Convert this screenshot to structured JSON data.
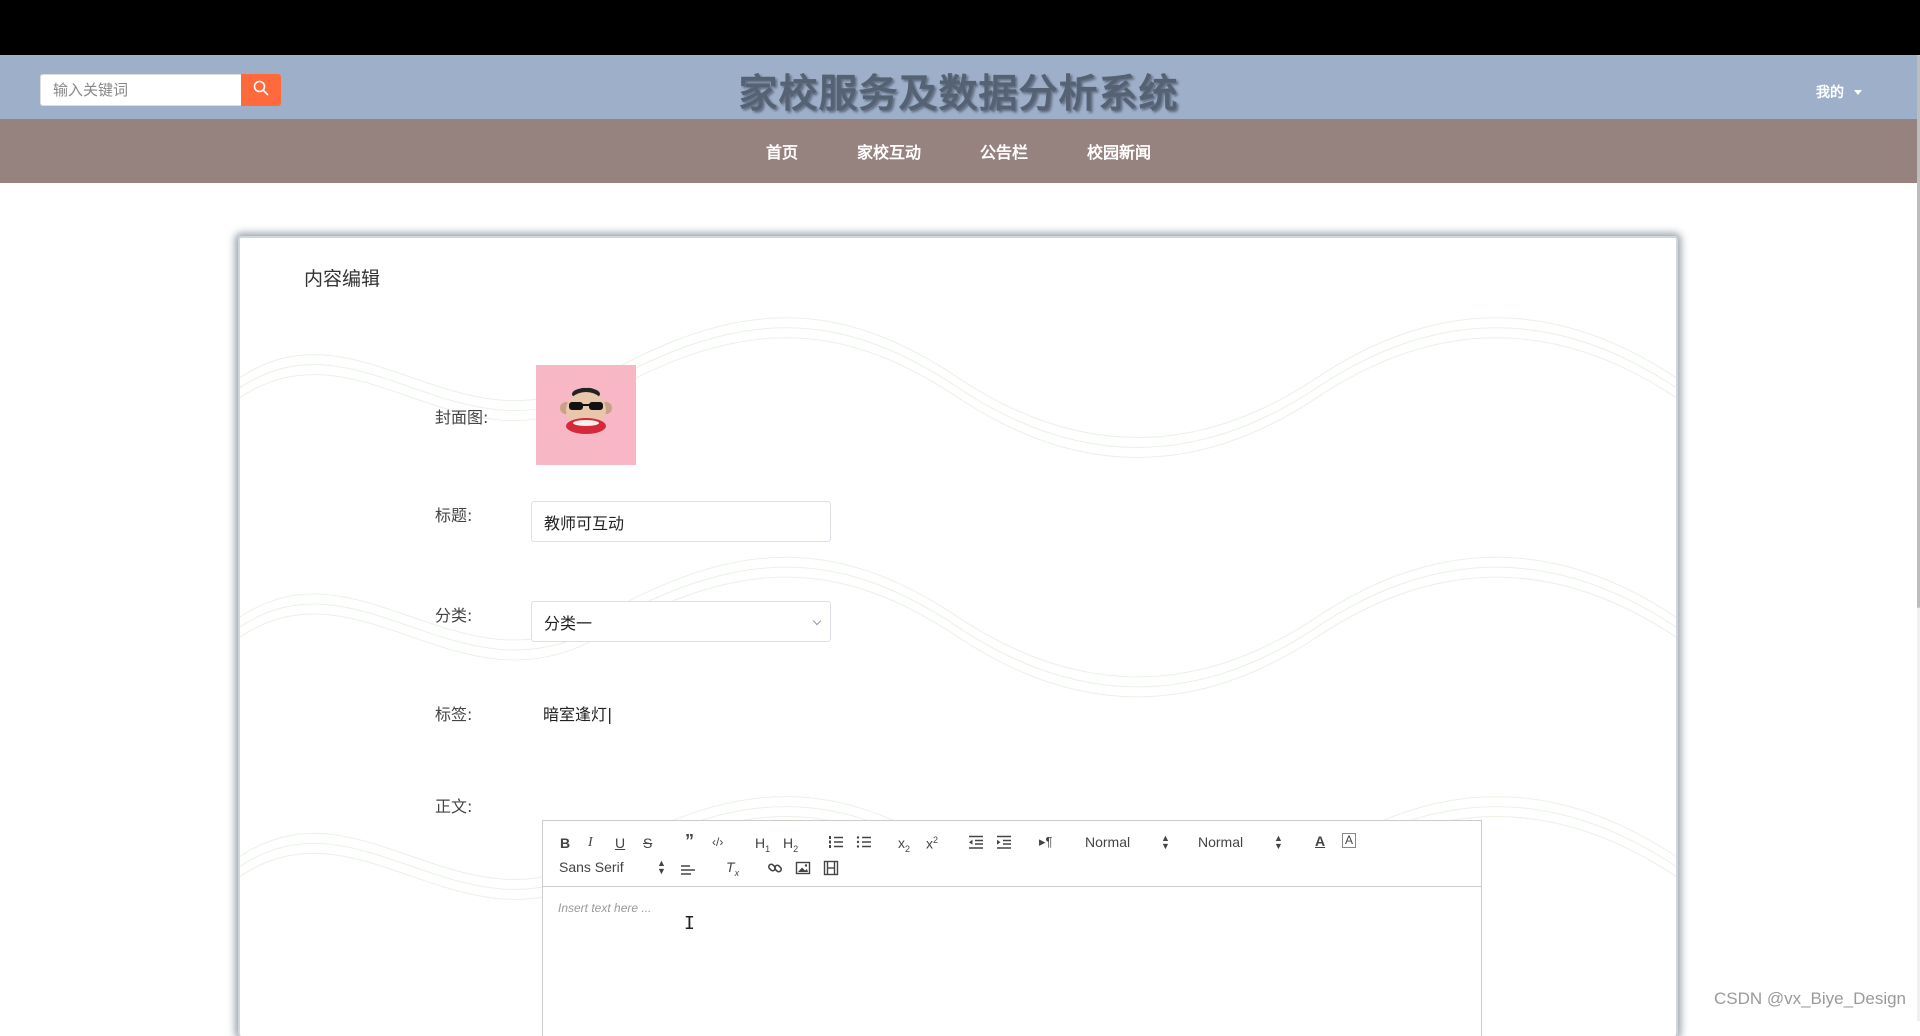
{
  "header": {
    "search_placeholder": "输入关键词",
    "site_title": "家校服务及数据分析系统",
    "user_menu": "我的"
  },
  "nav": {
    "items": [
      "首页",
      "家校互动",
      "公告栏",
      "校园新闻"
    ]
  },
  "form": {
    "panel_title": "内容编辑",
    "cover_label": "封面图:",
    "title_label": "标题:",
    "title_value": "教师可互动",
    "category_label": "分类:",
    "category_value": "分类一",
    "tags_label": "标签:",
    "tags_value": "暗室逢灯",
    "body_label": "正文:"
  },
  "editor": {
    "header_size": "Normal",
    "font_size": "Normal",
    "font_family": "Sans Serif",
    "placeholder": "Insert text here ..."
  },
  "watermark": "CSDN @vx_Biye_Design",
  "colors": {
    "header_bg": "#9eafc9",
    "nav_bg": "#96827f",
    "search_button": "#ff6a3d",
    "cover_bg": "#f7b7c4"
  }
}
